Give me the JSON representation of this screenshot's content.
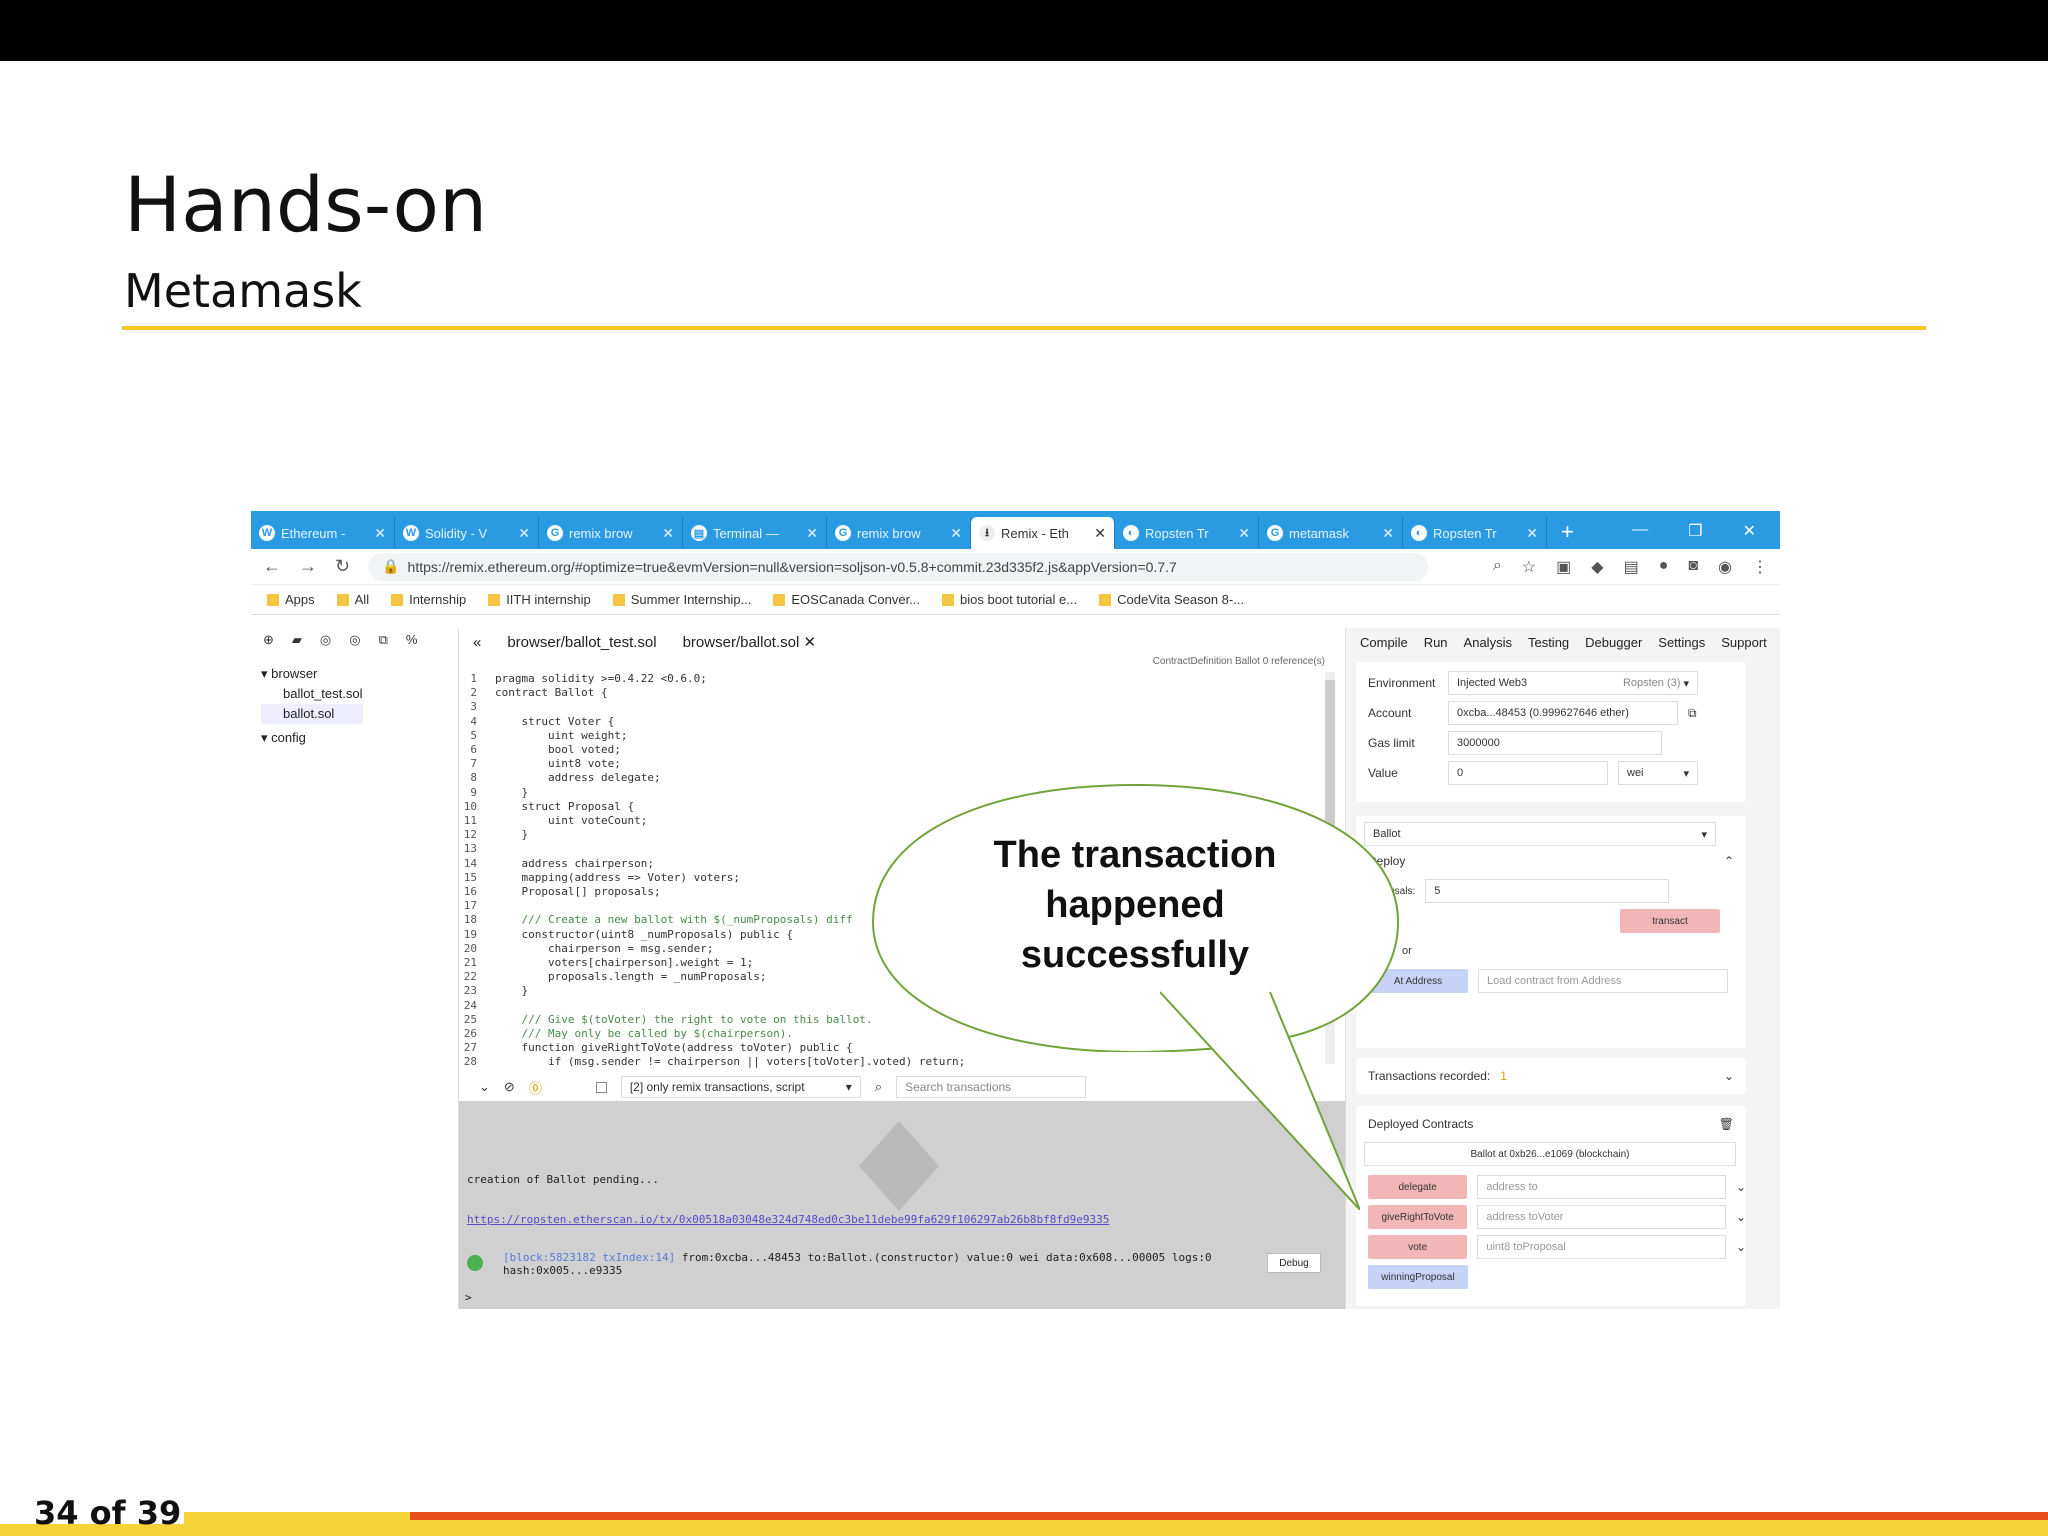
{
  "slide": {
    "title": "Hands-on",
    "subtitle": "Metamask",
    "page": "34 of 39"
  },
  "browser": {
    "tabs": [
      {
        "icon": "W",
        "label": "Ethereum -"
      },
      {
        "icon": "W",
        "label": "Solidity - V"
      },
      {
        "icon": "G",
        "label": "remix brow"
      },
      {
        "icon": "▤",
        "label": "Terminal —"
      },
      {
        "icon": "G",
        "label": "remix brow"
      },
      {
        "icon": "⭳",
        "label": "Remix - Eth",
        "active": true
      },
      {
        "icon": "◐",
        "label": "Ropsten Tr"
      },
      {
        "icon": "G",
        "label": "metamask"
      },
      {
        "icon": "◐",
        "label": "Ropsten Tr"
      }
    ],
    "url": "https://remix.ethereum.org/#optimize=true&evmVersion=null&version=soljson-v0.5.8+commit.23d335f2.js&appVersion=0.7.7",
    "bookmarks": [
      "Apps",
      "All",
      "Internship",
      "IITH internship",
      "Summer Internship...",
      "EOSCanada Conver...",
      "bios boot tutorial e...",
      "CodeVita Season 8-..."
    ]
  },
  "remix": {
    "tree": {
      "root": "browser",
      "files": [
        "ballot_test.sol",
        "ballot.sol"
      ],
      "folder": "config"
    },
    "editor_tabs": [
      "browser/ballot_test.sol",
      "browser/ballot.sol"
    ],
    "editor_header": "ContractDefinition  Ballot   0 reference(s)",
    "code_lines": [
      "pragma solidity >=0.4.22 <0.6.0;",
      "contract Ballot {",
      "",
      "    struct Voter {",
      "        uint weight;",
      "        bool voted;",
      "        uint8 vote;",
      "        address delegate;",
      "    }",
      "    struct Proposal {",
      "        uint voteCount;",
      "    }",
      "",
      "    address chairperson;",
      "    mapping(address => Voter) voters;",
      "    Proposal[] proposals;",
      "",
      "    /// Create a new ballot with $(_numProposals) diff",
      "    constructor(uint8 _numProposals) public {",
      "        chairperson = msg.sender;",
      "        voters[chairperson].weight = 1;",
      "        proposals.length = _numProposals;",
      "    }",
      "",
      "    /// Give $(toVoter) the right to vote on this ballot.",
      "    /// May only be called by $(chairperson).",
      "    function giveRightToVote(address toVoter) public {",
      "        if (msg.sender != chairperson || voters[toVoter].voted) return;"
    ],
    "terminal": {
      "filter": "[2] only remix transactions, script",
      "search_placeholder": "Search transactions",
      "pending": "creation of Ballot pending...",
      "link": "https://ropsten.etherscan.io/tx/0x00518a03048e324d748ed0c3be11debe99fa629f106297ab26b8bf8fd9e9335",
      "block": "[block:5823182 txIndex:14]",
      "detail": "from:0xcba...48453 to:Ballot.(constructor) value:0 wei data:0x608...00005 logs:0",
      "hash": "hash:0x005...e9335",
      "debug": "Debug",
      "prompt": ">"
    },
    "run_tabs": [
      "Compile",
      "Run",
      "Analysis",
      "Testing",
      "Debugger",
      "Settings",
      "Support"
    ],
    "env_label": "Environment",
    "env_value": "Injected Web3",
    "env_net": "Ropsten (3)",
    "account_label": "Account",
    "account_value": "0xcba...48453 (0.999627646 ether)",
    "gas_label": "Gas limit",
    "gas_value": "3000000",
    "value_label": "Value",
    "value_value": "0",
    "value_unit": "wei",
    "contract": "Ballot",
    "deploy_label": "Deploy",
    "proposals_label": "Proposals:",
    "proposals_value": "5",
    "transact": "transact",
    "or": "or",
    "at_address": "At Address",
    "at_address_placeholder": "Load contract from Address",
    "tx_recorded": "Transactions recorded:",
    "tx_count": "1",
    "deployed_title": "Deployed Contracts",
    "deployed_instance": "Ballot at 0xb26...e1069 (blockchain)",
    "functions": [
      {
        "name": "delegate",
        "placeholder": "address to",
        "color": "red"
      },
      {
        "name": "giveRightToVote",
        "placeholder": "address toVoter",
        "color": "red"
      },
      {
        "name": "vote",
        "placeholder": "uint8 toProposal",
        "color": "red"
      },
      {
        "name": "winningProposal",
        "placeholder": "",
        "color": "blue"
      }
    ]
  },
  "callout": {
    "line1": "The transaction",
    "line2": "happened",
    "line3": "successfully"
  }
}
